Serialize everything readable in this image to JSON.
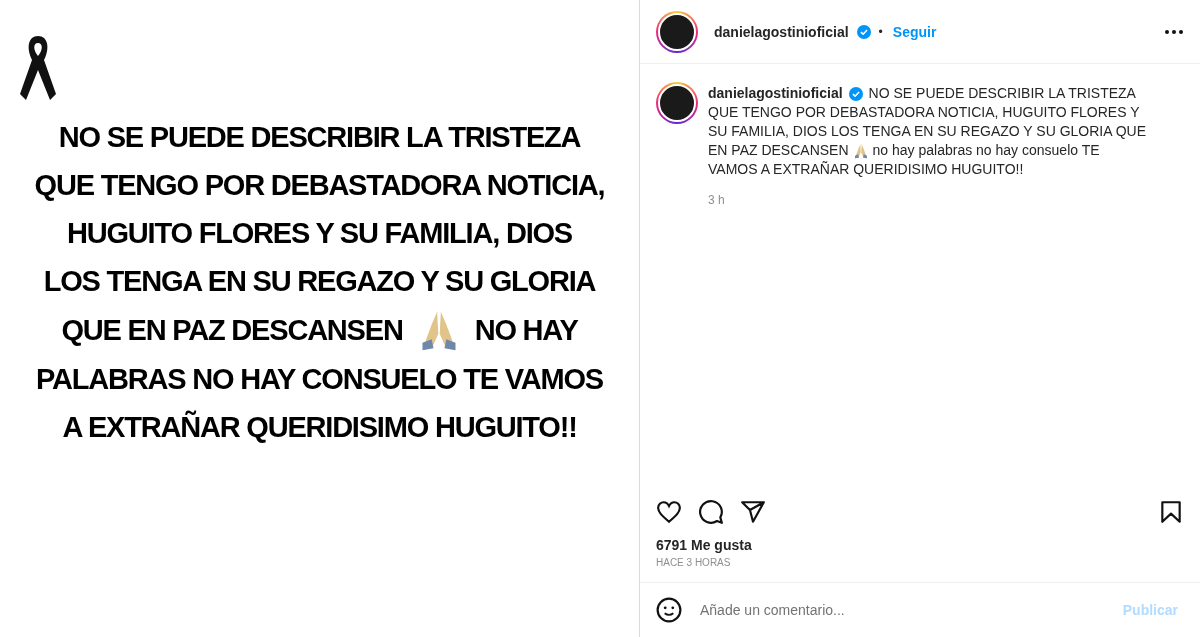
{
  "media": {
    "lines": [
      "NO SE PUEDE DESCRIBIR LA TRISTEZA",
      "QUE TENGO POR DEBASTADORA NOTICIA,",
      "HUGUITO FLORES Y SU FAMILIA, DIOS",
      "LOS TENGA EN SU REGAZO Y SU GLORIA",
      "QUE EN PAZ DESCANSEN",
      "NO HAY",
      "PALABRAS NO HAY CONSUELO TE VAMOS",
      "A EXTRAÑAR QUERIDISIMO HUGUITO!!"
    ]
  },
  "header": {
    "username": "danielagostinioficial",
    "verified": true,
    "separator": "•",
    "follow": "Seguir"
  },
  "caption": {
    "username": "danielagostinioficial",
    "verified": true,
    "lines": [
      [
        "NO SE PUEDE DESCRIBIR LA TRISTEZA"
      ],
      [
        "QUE TENGO POR DEBASTADORA NOTICIA, HUGUITO FLORES Y"
      ],
      [
        "SU FAMILIA, DIOS LOS TENGA EN SU REGAZO Y SU GLORIA QUE"
      ],
      [
        "EN PAZ DESCANSEN",
        "no hay palabras no hay consuelo TE"
      ],
      [
        "VAMOS A EXTRAÑAR QUERIDISIMO HUGUITO!!"
      ]
    ],
    "time": "3 h"
  },
  "likes": "6791 Me gusta",
  "posted": "HACE 3 HORAS",
  "comment": {
    "placeholder": "Añade un comentario...",
    "submit": "Publicar"
  }
}
